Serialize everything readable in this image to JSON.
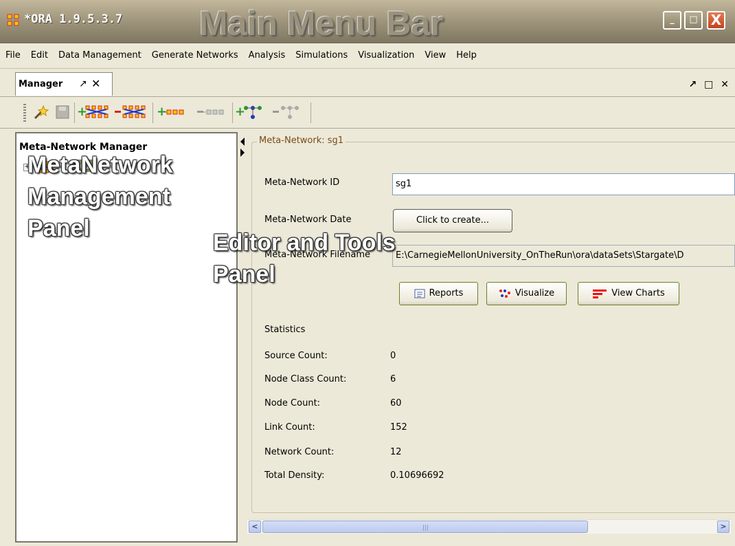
{
  "window": {
    "title": "*ORA 1.9.5.3.7",
    "minimize_label": "_",
    "maximize_label": "□",
    "close_label": "X"
  },
  "annotations": {
    "main_menu_bar": "Main Menu Bar",
    "metanetwork_panel_line1": "MetaNetwork",
    "metanetwork_panel_line2": "Management",
    "metanetwork_panel_line3": "Panel",
    "editor_panel_line1": "Editor and Tools",
    "editor_panel_line2": "Panel"
  },
  "menu": {
    "items": [
      "File",
      "Edit",
      "Data Management",
      "Generate Networks",
      "Analysis",
      "Simulations",
      "Visualization",
      "View",
      "Help"
    ]
  },
  "tab": {
    "label": "Manager",
    "pin": "↗",
    "close": "✕",
    "dock_controls": "↗ □ ✕"
  },
  "toolbar": {
    "icons": [
      "wand-icon",
      "save-icon",
      "add-metanetwork-icon",
      "remove-metanetwork-icon",
      "add-nodeset-icon",
      "remove-nodeset-icon",
      "add-network-icon",
      "remove-network-icon"
    ]
  },
  "manager": {
    "title": "Meta-Network Manager",
    "tree": [
      {
        "label": "sg1",
        "expander": "+"
      }
    ]
  },
  "editor": {
    "group_title": "Meta-Network: sg1",
    "id_label": "Meta-Network ID",
    "id_value": "sg1",
    "date_label": "Meta-Network Date",
    "date_button": "Click to create...",
    "filename_label": "Meta-Network Filename",
    "filename_value": "E:\\CarnegieMellonUniversity_OnTheRun\\ora\\dataSets\\Stargate\\D",
    "reports_button": "Reports",
    "visualize_button": "Visualize",
    "charts_button": "View Charts"
  },
  "statistics": {
    "heading": "Statistics",
    "rows": [
      {
        "label": "Source Count:",
        "value": "0"
      },
      {
        "label": "Node Class Count:",
        "value": "6"
      },
      {
        "label": "Node Count:",
        "value": "60"
      },
      {
        "label": "Link Count:",
        "value": "152"
      },
      {
        "label": "Network Count:",
        "value": "12"
      },
      {
        "label": "Total Density:",
        "value": "0.10696692"
      }
    ]
  },
  "scrollbar": {
    "left_arrow": "<",
    "right_arrow": ">",
    "grip": "|||"
  },
  "colors": {
    "titlebar": "#9b9178",
    "background": "#ece9d8",
    "tree_selection": "#7e8c64",
    "group_legend": "#7a4b1b"
  }
}
